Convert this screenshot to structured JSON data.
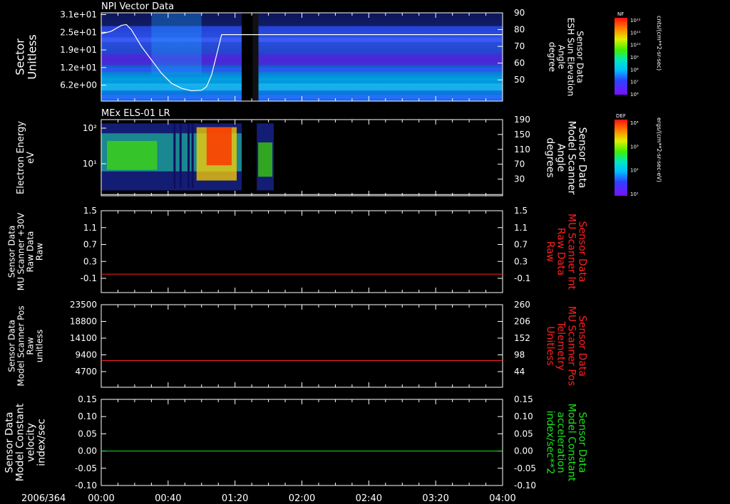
{
  "chart_data": [
    {
      "type": "heatmap",
      "title": "NPI Vector Data",
      "ylabel_left": [
        "Sector",
        "Unitless"
      ],
      "yticks_left": [
        "3.1e+01",
        "2.5e+01",
        "1.9e+01",
        "1.2e+01",
        "6.2e+00"
      ],
      "ylabel_right": [
        "Sensor Data",
        "ESH Sun Elevation",
        "Angle",
        "degree"
      ],
      "yticks_right": [
        "90",
        "80",
        "70",
        "60",
        "50"
      ],
      "ylim_right": [
        40,
        90
      ],
      "data_gap_hours": [
        1.4,
        1.51
      ],
      "overlay_series": {
        "axis": "right",
        "color": "#ffffff",
        "x_hours": [
          0.0,
          0.1,
          0.2,
          0.25,
          0.3,
          0.4,
          0.5,
          0.6,
          0.7,
          0.8,
          0.9,
          1.0,
          1.05,
          1.1,
          1.15,
          1.2,
          1.3,
          1.5,
          2.0,
          3.0,
          4.0
        ],
        "values": [
          77.5,
          79,
          82.5,
          83,
          80,
          70,
          62,
          54,
          48,
          45,
          43.5,
          43.8,
          46,
          53,
          65,
          77,
          77,
          77,
          77,
          77,
          77
        ]
      },
      "colorbar": {
        "label": "NF",
        "units": "cnts/(cm**2-sr-sec)",
        "ticks": [
          "10¹²",
          "10¹¹",
          "10¹⁰",
          "10⁹",
          "10⁸",
          "10⁷",
          "10⁶"
        ]
      }
    },
    {
      "type": "heatmap",
      "title": "MEx ELS-01 LR",
      "ylabel_left": [
        "Electron Energy",
        "eV"
      ],
      "yticks_left": [
        "10²",
        "10¹"
      ],
      "ylabel_right": [
        "Sensor Data",
        "Model Scanner",
        "Angle",
        "degrees"
      ],
      "yticks_right": [
        "190",
        "150",
        "110",
        "70",
        "30"
      ],
      "ylim_right": [
        10,
        190
      ],
      "data_gap_hours": [
        1.4,
        1.55
      ],
      "data_end_hours": 1.72,
      "overlay_series": {
        "axis": "right",
        "color": "#ffffff",
        "value": 13
      },
      "colorbar": {
        "label": "DEF",
        "units": "ergs/(cm**2-sr-sec-eV)",
        "ticks": [
          "10⁴",
          "10³",
          "10²",
          "10¹"
        ]
      }
    },
    {
      "type": "line",
      "ylabel_left": [
        "Sensor Data",
        "MU Scanner +30V",
        "Raw Data",
        "Raw"
      ],
      "yticks_left": [
        "1.5",
        "1.1",
        "0.7",
        "0.3",
        "-0.1"
      ],
      "ylim": [
        -0.3,
        1.5
      ],
      "ylabel_right": [
        "Sensor Data",
        "MU Scanner Int",
        "Raw Data",
        "Raw"
      ],
      "yticks_right": [
        "1.5",
        "1.1",
        "0.7",
        "0.3",
        "-0.1"
      ],
      "series": [
        {
          "color": "#ff2020",
          "constant": 0.0
        }
      ],
      "right_label_color": "#ff2020"
    },
    {
      "type": "line",
      "ylabel_left": [
        "Sensor Data",
        "Model Scanner Pos",
        "Raw",
        "unitless"
      ],
      "yticks_left": [
        "23500",
        "18800",
        "14100",
        "9400",
        "4700"
      ],
      "ylim": [
        0,
        23500
      ],
      "ylabel_right": [
        "Sensor Data",
        "MU Scanner Pos",
        "Telemetry",
        "Unitless"
      ],
      "yticks_right": [
        "260",
        "206",
        "152",
        "98",
        "44"
      ],
      "series": [
        {
          "color": "#ff2020",
          "constant": 7800
        }
      ],
      "right_label_color": "#ff2020"
    },
    {
      "type": "line",
      "ylabel_left": [
        "Sensor Data",
        "Model Constant",
        "velocity",
        "index/sec"
      ],
      "yticks_left": [
        "0.15",
        "0.10",
        "0.05",
        "0.00",
        "-0.05",
        "-0.10"
      ],
      "ylim": [
        -0.1,
        0.15
      ],
      "ylabel_right": [
        "Sensor Data",
        "Model Constant",
        "acceleration",
        "index/sec**2"
      ],
      "yticks_right": [
        "0.15",
        "0.10",
        "0.05",
        "0.00",
        "-0.05",
        "-0.10"
      ],
      "series": [
        {
          "color": "#20e020",
          "constant": 0.0
        }
      ],
      "right_label_color": "#20e020"
    }
  ],
  "x_axis": {
    "date_label": "2006/364",
    "tick_labels": [
      "00:00",
      "00:40",
      "01:20",
      "02:00",
      "02:40",
      "03:20",
      "04:00"
    ],
    "range_hours": [
      0,
      4
    ]
  },
  "colors": {
    "background": "#000000",
    "foreground": "#ffffff"
  }
}
